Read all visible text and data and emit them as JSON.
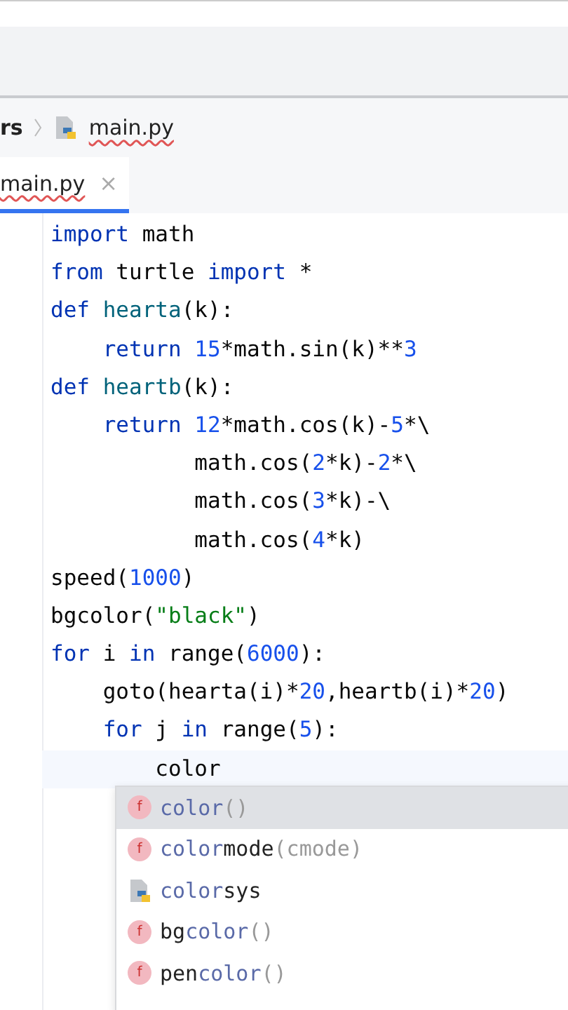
{
  "breadcrumb": {
    "folder": "rs",
    "file": "main.py"
  },
  "tabs": [
    {
      "label": "main.py",
      "close": "×",
      "selected": true
    }
  ],
  "code": [
    {
      "tokens": [
        {
          "kind": "keyword",
          "text": "import"
        },
        {
          "kind": "plain",
          "text": " math"
        }
      ]
    },
    {
      "tokens": [
        {
          "kind": "keyword",
          "text": "from"
        },
        {
          "kind": "plain",
          "text": " turtle "
        },
        {
          "kind": "keyword",
          "text": "import"
        },
        {
          "kind": "plain",
          "text": " *"
        }
      ]
    },
    {
      "tokens": [
        {
          "kind": "keyword",
          "text": "def"
        },
        {
          "kind": "func",
          "text": " hearta"
        },
        {
          "kind": "plain",
          "text": "(k):"
        }
      ]
    },
    {
      "tokens": [
        {
          "kind": "keyword",
          "text": "    return"
        },
        {
          "kind": "number",
          "text": " 15"
        },
        {
          "kind": "plain",
          "text": "*math.sin(k)**"
        },
        {
          "kind": "number",
          "text": "3"
        }
      ]
    },
    {
      "tokens": [
        {
          "kind": "keyword",
          "text": "def"
        },
        {
          "kind": "func",
          "text": " heartb"
        },
        {
          "kind": "plain",
          "text": "(k):"
        }
      ]
    },
    {
      "tokens": [
        {
          "kind": "keyword",
          "text": "    return"
        },
        {
          "kind": "number",
          "text": " 12"
        },
        {
          "kind": "plain",
          "text": "*math.cos(k)-"
        },
        {
          "kind": "number",
          "text": "5"
        },
        {
          "kind": "plain",
          "text": "*\\"
        }
      ]
    },
    {
      "tokens": [
        {
          "kind": "plain",
          "text": "           math.cos("
        },
        {
          "kind": "number",
          "text": "2"
        },
        {
          "kind": "plain",
          "text": "*k)-"
        },
        {
          "kind": "number",
          "text": "2"
        },
        {
          "kind": "plain",
          "text": "*\\"
        }
      ]
    },
    {
      "tokens": [
        {
          "kind": "plain",
          "text": "           math.cos("
        },
        {
          "kind": "number",
          "text": "3"
        },
        {
          "kind": "plain",
          "text": "*k)-\\"
        }
      ]
    },
    {
      "tokens": [
        {
          "kind": "plain",
          "text": "           math.cos("
        },
        {
          "kind": "number",
          "text": "4"
        },
        {
          "kind": "plain",
          "text": "*k)"
        }
      ]
    },
    {
      "tokens": [
        {
          "kind": "plain",
          "text": "speed("
        },
        {
          "kind": "number",
          "text": "1000"
        },
        {
          "kind": "plain",
          "text": ")"
        }
      ]
    },
    {
      "tokens": [
        {
          "kind": "plain",
          "text": "bgcolor("
        },
        {
          "kind": "string",
          "text": "\"black\""
        },
        {
          "kind": "plain",
          "text": ")"
        }
      ]
    },
    {
      "tokens": [
        {
          "kind": "keyword",
          "text": "for"
        },
        {
          "kind": "plain",
          "text": " i "
        },
        {
          "kind": "keyword",
          "text": "in"
        },
        {
          "kind": "plain",
          "text": " range("
        },
        {
          "kind": "number",
          "text": "6000"
        },
        {
          "kind": "plain",
          "text": "):"
        }
      ]
    },
    {
      "tokens": [
        {
          "kind": "plain",
          "text": "    goto(hearta(i)*"
        },
        {
          "kind": "number",
          "text": "20"
        },
        {
          "kind": "plain",
          "text": ",heartb(i)*"
        },
        {
          "kind": "number",
          "text": "20"
        },
        {
          "kind": "plain",
          "text": ")"
        }
      ]
    },
    {
      "tokens": [
        {
          "kind": "keyword",
          "text": "    for"
        },
        {
          "kind": "plain",
          "text": " j "
        },
        {
          "kind": "keyword",
          "text": "in"
        },
        {
          "kind": "plain",
          "text": " range("
        },
        {
          "kind": "number",
          "text": "5"
        },
        {
          "kind": "plain",
          "text": "):"
        }
      ]
    },
    {
      "tokens": [
        {
          "kind": "plain",
          "text": "        color"
        }
      ],
      "current": true
    }
  ],
  "completion": [
    {
      "kind": "function",
      "selected": true,
      "badge": "f",
      "parts": [
        {
          "kind": "match",
          "text": "color"
        },
        {
          "kind": "params",
          "text": "()"
        }
      ]
    },
    {
      "kind": "function",
      "selected": false,
      "badge": "f",
      "parts": [
        {
          "kind": "match",
          "text": "color"
        },
        {
          "kind": "rest",
          "text": "mode"
        },
        {
          "kind": "params",
          "text": "(cmode)"
        }
      ]
    },
    {
      "kind": "module",
      "selected": false,
      "parts": [
        {
          "kind": "match",
          "text": "color"
        },
        {
          "kind": "rest",
          "text": "sys"
        }
      ]
    },
    {
      "kind": "function",
      "selected": false,
      "badge": "f",
      "parts": [
        {
          "kind": "rest",
          "text": "bg"
        },
        {
          "kind": "match",
          "text": "color"
        },
        {
          "kind": "params",
          "text": "()"
        }
      ]
    },
    {
      "kind": "function",
      "selected": false,
      "badge": "f",
      "parts": [
        {
          "kind": "rest",
          "text": "pen"
        },
        {
          "kind": "match",
          "text": "color"
        },
        {
          "kind": "params",
          "text": "()"
        }
      ]
    }
  ]
}
